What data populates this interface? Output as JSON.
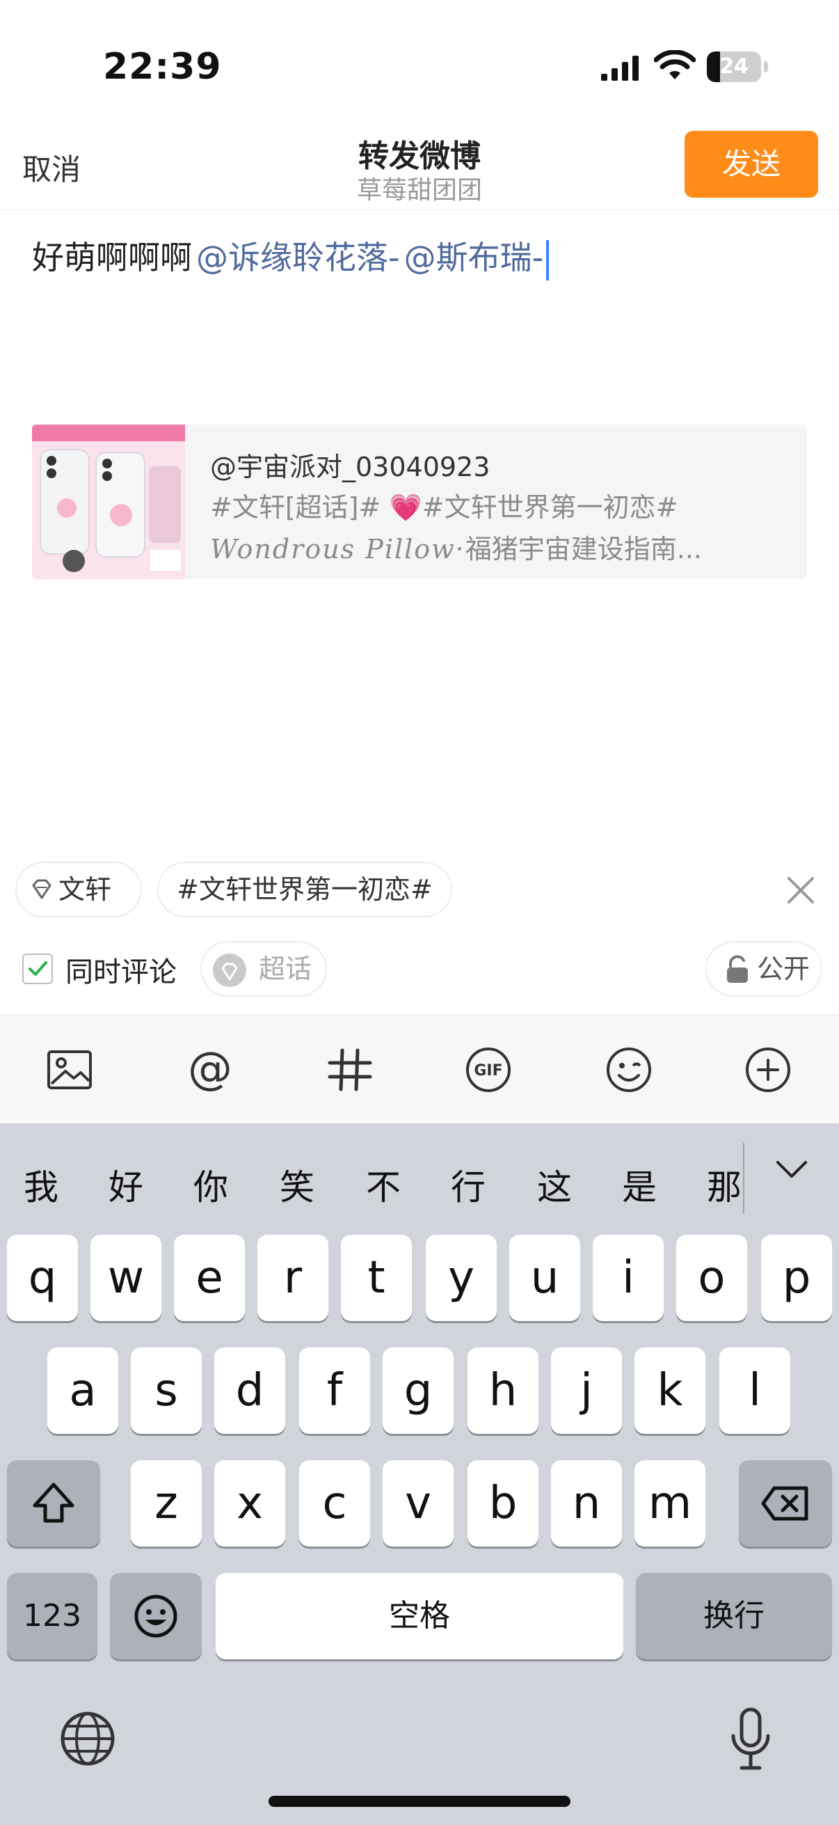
{
  "status": {
    "time": "22:39",
    "battery": "24",
    "battery_level": 0.24
  },
  "header": {
    "cancel": "取消",
    "title": "转发微博",
    "subtitle": "草莓甜团团",
    "send": "发送"
  },
  "compose": {
    "text": "好萌啊啊啊",
    "mention1": "@诉缘聆花落-",
    "mention2": "@斯布瑞-"
  },
  "quote": {
    "author": "@宇宙派对_03040923",
    "line2_a": "#文轩[超话]#",
    "line2_emoji": "💗",
    "line2_b": "#文轩世界第一初恋#",
    "line3_script": "Wondrous Pillow·",
    "line3_rest": "福猪宇宙建设指南..."
  },
  "tags": {
    "wenxuan": "文轩",
    "topic": "#文轩世界第一初恋#"
  },
  "options": {
    "comment_label": "同时评论",
    "comment_checked": true,
    "super_topic": "超话",
    "visibility": "公开"
  },
  "toolbar": [
    "image-icon",
    "at-icon",
    "hashtag-icon",
    "gif-icon",
    "emoji-icon",
    "add-icon"
  ],
  "keyboard": {
    "candidates": [
      "我",
      "好",
      "你",
      "笑",
      "不",
      "行",
      "这",
      "是",
      "那"
    ],
    "row1": [
      "q",
      "w",
      "e",
      "r",
      "t",
      "y",
      "u",
      "i",
      "o",
      "p"
    ],
    "row2": [
      "a",
      "s",
      "d",
      "f",
      "g",
      "h",
      "j",
      "k",
      "l"
    ],
    "row3": [
      "z",
      "x",
      "c",
      "v",
      "b",
      "n",
      "m"
    ],
    "num_key": "123",
    "space_key": "空格",
    "return_key": "换行"
  },
  "colors": {
    "send_button": "#ff8c19",
    "mention": "#506a9e",
    "keyboard_bg": "#d1d4db"
  }
}
